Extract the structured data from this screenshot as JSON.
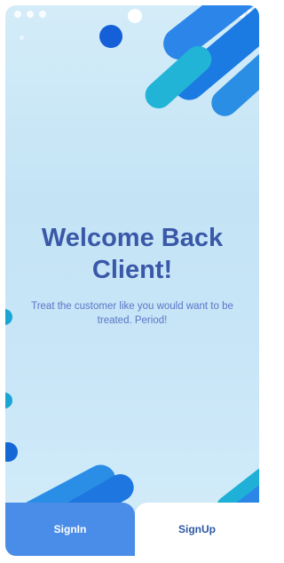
{
  "screen": {
    "title_line1": "Welcome Back",
    "title_line2": "Client!",
    "subtitle": "Treat the customer like you would want to be treated. Period!"
  },
  "actions": {
    "signin_label": "SignIn",
    "signup_label": "SignUp"
  },
  "colors": {
    "title": "#3a58a8",
    "subtitle": "#5a76c8",
    "signin_bg": "#4a8de8",
    "signup_text": "#2f58a4",
    "accent_blue": "#1d6fe0",
    "accent_teal": "#1fb3d6"
  }
}
